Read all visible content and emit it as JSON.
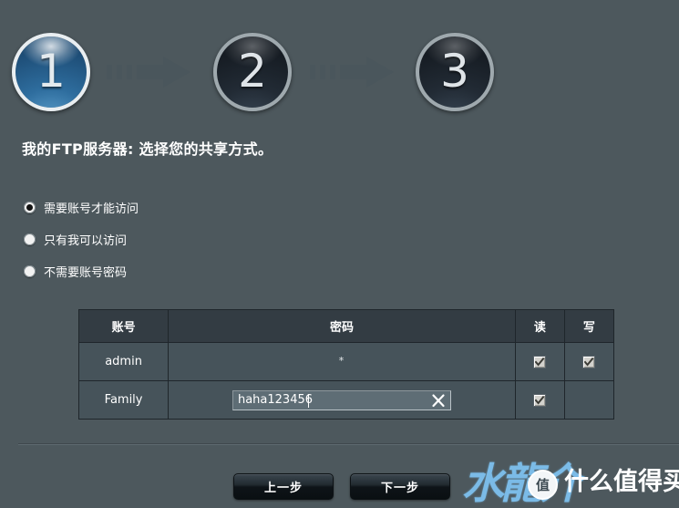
{
  "wizard": {
    "steps": [
      {
        "number": "1",
        "state": "active"
      },
      {
        "number": "2",
        "state": "idle"
      },
      {
        "number": "3",
        "state": "idle"
      }
    ]
  },
  "page": {
    "title": "我的FTP服务器: 选择您的共享方式。"
  },
  "access_options": [
    {
      "label": "需要账号才能访问",
      "selected": true
    },
    {
      "label": "只有我可以访问",
      "selected": false
    },
    {
      "label": "不需要账号密码",
      "selected": false
    }
  ],
  "account_table": {
    "headers": [
      "账号",
      "密码",
      "读",
      "写"
    ],
    "rows": [
      {
        "user": "admin",
        "password_display": "*",
        "password_editing": false,
        "read": true,
        "write": true
      },
      {
        "user": "Family",
        "password_value": "haha123456",
        "password_editing": true,
        "read": true,
        "write": false
      }
    ]
  },
  "footer": {
    "prev_label": "上一步",
    "next_label": "下一步"
  },
  "watermark": {
    "calligraphy": "水龍介",
    "badge": "值",
    "site": "什么值得买"
  },
  "colors": {
    "background": "#4d585d",
    "table_header": "#333c43",
    "table_cell": "#46535a",
    "step_active": "#2e7cb4",
    "step_idle": "#222b35",
    "accent_text": "#ffffff",
    "watermark_blue": "#7ec1ef"
  }
}
